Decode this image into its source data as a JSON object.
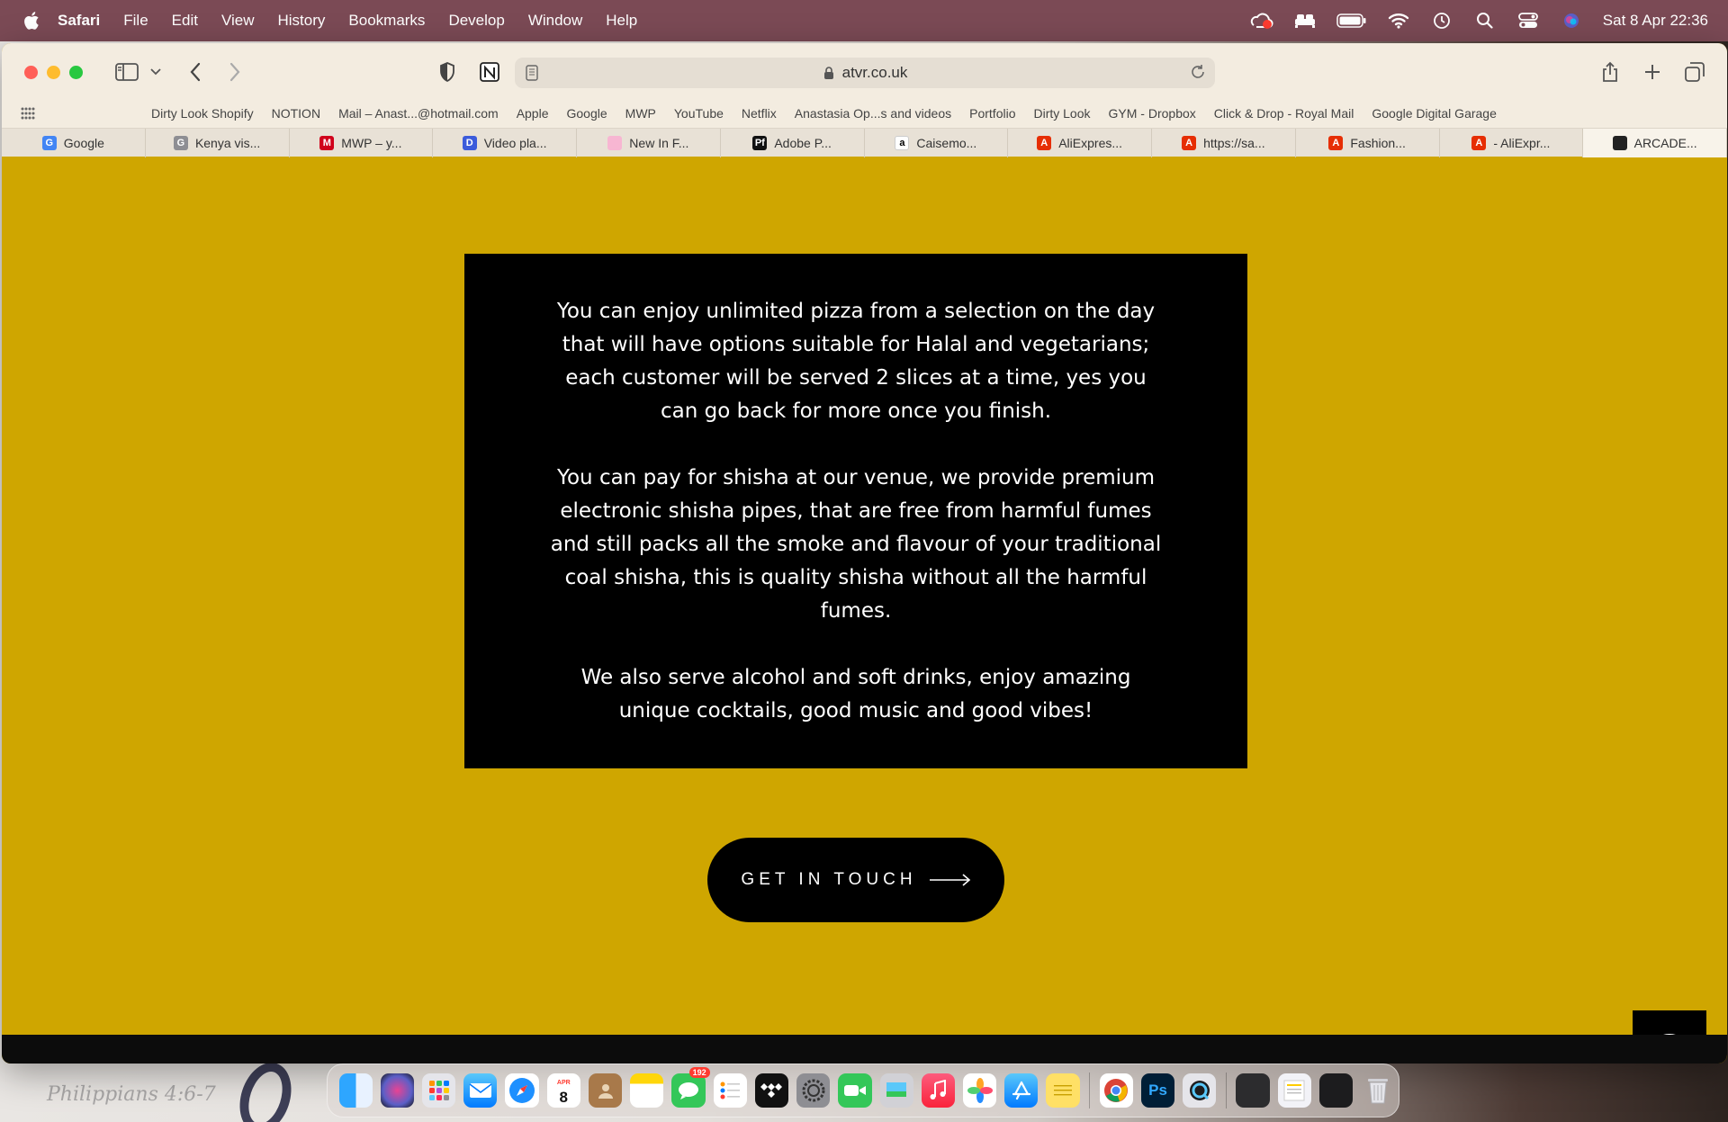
{
  "menubar": {
    "app_name": "Safari",
    "items": [
      "File",
      "Edit",
      "View",
      "History",
      "Bookmarks",
      "Develop",
      "Window",
      "Help"
    ],
    "clock": "Sat 8 Apr  22:36"
  },
  "toolbar": {
    "url": "atvr.co.uk"
  },
  "favourites": [
    "Dirty Look Shopify",
    "NOTION",
    "Mail – Anast...@hotmail.com",
    "Apple",
    "Google",
    "MWP",
    "YouTube",
    "Netflix",
    "Anastasia Op...s and videos",
    "Portfolio",
    "Dirty Look",
    "GYM - Dropbox",
    "Click & Drop - Royal Mail",
    "Google Digital Garage"
  ],
  "tabs": [
    {
      "label": "Google",
      "icon": "G",
      "color": "#4285f4"
    },
    {
      "label": "Kenya vis...",
      "icon": "G",
      "color": "#8e8e93"
    },
    {
      "label": "MWP – y...",
      "icon": "M",
      "color": "#d0021b"
    },
    {
      "label": "Video pla...",
      "icon": "D",
      "color": "#3b5bdb"
    },
    {
      "label": "New In F...",
      "icon": "",
      "color": "#f7b6d2"
    },
    {
      "label": "Adobe P...",
      "icon": "Pf",
      "color": "#111111"
    },
    {
      "label": "Caisemo...",
      "icon": "a",
      "color": "#ffffff"
    },
    {
      "label": "AliExpres...",
      "icon": "A",
      "color": "#e62e04"
    },
    {
      "label": "https://sa...",
      "icon": "A",
      "color": "#e62e04"
    },
    {
      "label": "Fashion...",
      "icon": "A",
      "color": "#e62e04"
    },
    {
      "label": "- AliExpr...",
      "icon": "A",
      "color": "#e62e04"
    },
    {
      "label": "ARCADE...",
      "icon": "",
      "color": "#222222"
    }
  ],
  "content": {
    "paragraphs": [
      "You can enjoy unlimited pizza from a selection on the day that will have options suitable for Halal and vegetarians; each customer will be served 2 slices at a time, yes you can go back for more once you finish.",
      "You can pay for shisha at our venue, we provide premium electronic shisha pipes, that are free from harmful fumes and still packs all the smoke and flavour of your traditional coal shisha, this is quality shisha without all the harmful fumes.",
      "We also serve alcohol and soft drinks, enjoy amazing unique cocktails, good music and good vibes!"
    ],
    "cta_label": "GET IN TOUCH"
  },
  "desktop": {
    "note": "Philippians 4:6-7"
  },
  "dock": {
    "calendar_day": "8",
    "calendar_month": "APR",
    "messages_badge": "192"
  },
  "colors": {
    "page_background": "#cfa600",
    "info_box": "#000000",
    "menubar": "#7b4a55"
  }
}
